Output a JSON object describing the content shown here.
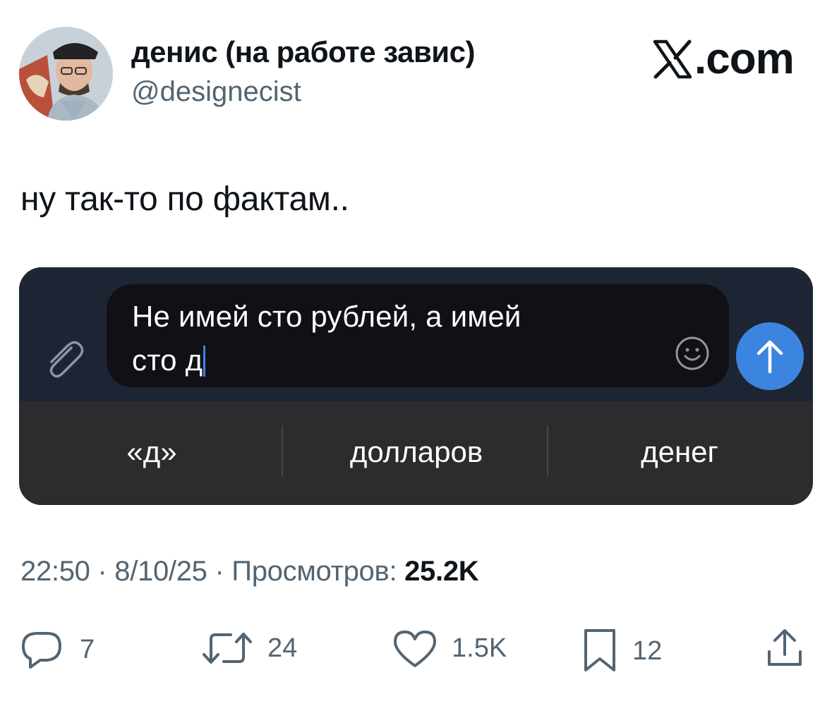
{
  "author": {
    "display_name": "денис (на работе завис)",
    "handle": "@designecist",
    "avatar_icon": "avatar-photo"
  },
  "brand": {
    "name": ".com",
    "logo_icon": "x-logo-icon"
  },
  "tweet": {
    "text": "ну так-то по фактам.."
  },
  "embedded_screenshot": {
    "input_line1": "Не имей сто рублей, а имей",
    "input_line2": "сто д",
    "attach_icon": "paperclip-icon",
    "emoji_icon": "emoji-icon",
    "send_icon": "arrow-up-icon",
    "suggestions": [
      "«д»",
      "долларов",
      "денег"
    ],
    "colors": {
      "top_bg": "#1d2535",
      "bubble_bg": "#111115",
      "keyboard_bg": "#2c2c2e",
      "send_button": "#3b85e0",
      "caret": "#3a82f7"
    }
  },
  "meta": {
    "time": "22:50",
    "date": "8/10/25",
    "views_label": "Просмотров:",
    "views_count": "25.2K"
  },
  "actions": {
    "reply_count": "7",
    "retweet_count": "24",
    "like_count": "1.5K",
    "bookmark_count": "12"
  }
}
